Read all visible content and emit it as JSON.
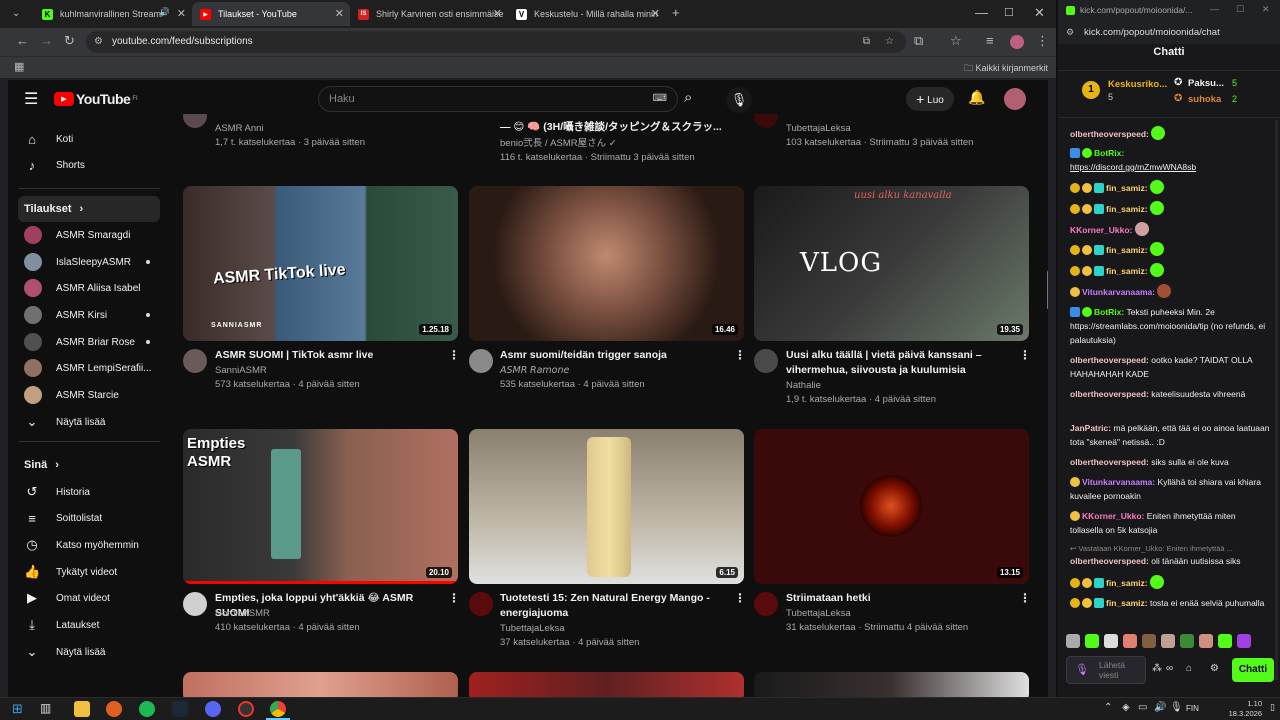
{
  "browser": {
    "tabs": [
      {
        "title": "kuhlmanvirallinen Stream -",
        "favicon": "K",
        "fav_color": "#53fc18"
      },
      {
        "title": "Tilaukset - YouTube",
        "favicon": "▶",
        "fav_color": "#ff0000"
      },
      {
        "title": "Shirly Karvinen osti ensimmäise",
        "favicon": "IS",
        "fav_color": "#d92020"
      },
      {
        "title": "Keskustelu - Millä rahalla minin",
        "favicon": "V",
        "fav_color": "#ffffff"
      }
    ],
    "url": "youtube.com/feed/subscriptions",
    "bookmarks_label": "Kaikki kirjanmerkit"
  },
  "youtube": {
    "logo_text": "YouTube",
    "logo_region": "FI",
    "search_placeholder": "Haku",
    "create_label": "Luo",
    "sidebar": {
      "main": [
        {
          "label": "Koti",
          "icon": "home-icon"
        },
        {
          "label": "Shorts",
          "icon": "shorts-icon"
        }
      ],
      "subs_heading": "Tilaukset",
      "subs": [
        {
          "label": "ASMR Smaragdi",
          "color": "#a04060",
          "dot": false
        },
        {
          "label": "IslaSleepyASMR",
          "color": "#8090a0",
          "dot": true
        },
        {
          "label": "ASMR Aliisa Isabel",
          "color": "#b05070",
          "dot": false
        },
        {
          "label": "ASMR Kirsi",
          "color": "#707070",
          "dot": true
        },
        {
          "label": "ASMR Briar Rose",
          "color": "#505050",
          "dot": true
        },
        {
          "label": "ASMR LempiSerafii...",
          "color": "#907060",
          "dot": false
        },
        {
          "label": "ASMR Starcie",
          "color": "#c0a080",
          "dot": false
        }
      ],
      "show_more": "Näytä lisää",
      "you_heading": "Sinä",
      "you": [
        {
          "label": "Historia",
          "icon": "history-icon"
        },
        {
          "label": "Soittolistat",
          "icon": "playlists-icon"
        },
        {
          "label": "Katso myöhemmin",
          "icon": "watch-later-icon"
        },
        {
          "label": "Tykätyt videot",
          "icon": "liked-icon"
        },
        {
          "label": "Omat videot",
          "icon": "your-videos-icon"
        },
        {
          "label": "Lataukset",
          "icon": "downloads-icon"
        }
      ],
      "show_more_2": "Näytä lisää"
    },
    "top_partial": [
      {
        "channel": "ASMR Anni",
        "meta": "1,7 t. katselukertaa · 3 päivää sitten"
      },
      {
        "title": "— 😊 🧠 (3H/囁き雑談/タッピング＆スクラッ...",
        "channel": "benio弐長 / ASMR屋さん ✓",
        "meta": "116 t. katselukertaa · Striimattu 3 päivää sitten"
      },
      {
        "channel": "TubettajaLeksa",
        "meta": "103 katselukertaa · Striimattu 3 päivää sitten"
      }
    ],
    "videos": [
      {
        "title": "ASMR SUOMI | TikTok asmr live",
        "channel": "SanniASMR",
        "meta": "573 katselukertaa · 4 päivää sitten",
        "duration": "1.25.18",
        "thumb_text": "ASMR TikTok live",
        "thumb_sub": "SANNIASMR"
      },
      {
        "title": "Asmr suomi/teidän trigger sanoja",
        "channel": "𝘈𝘚𝘔𝘙 𝘙𝘢𝘮𝘰𝘯𝘦",
        "meta": "535 katselukertaa · 4 päivää sitten",
        "duration": "16.46"
      },
      {
        "title": "Uusi alku täällä | vietä päivä kanssani – vihermehua, siivousta ja kuulumisia",
        "channel": "Nathalie",
        "meta": "1,9 t. katselukertaa · 4 päivää sitten",
        "duration": "19.35",
        "thumb_text": "VLOG",
        "thumb_sub": "uusi alku kanavalla"
      },
      {
        "title": "Empties, joka loppui yht'äkkiä 😂 ASMR SUOMI",
        "channel": "NordicASMR",
        "meta": "410 katselukertaa · 4 päivää sitten",
        "duration": "20.10",
        "thumb_text": "Empties ASMR"
      },
      {
        "title": "Tuotetesti 15: Zen Natural Energy Mango - energiajuoma",
        "channel": "TubettajaLeksa",
        "meta": "37 katselukertaa · 4 päivää sitten",
        "duration": "6.15"
      },
      {
        "title": "Striimataan hetki",
        "channel": "TubettajaLeksa",
        "meta": "31 katselukertaa · Striimattu 4 päivää sitten",
        "duration": "13.15"
      }
    ]
  },
  "chat": {
    "popout_url": "kick.com/popout/moioonida/...",
    "address": "kick.com/popout/moioonida/chat",
    "title": "Chatti",
    "leaderboard": [
      {
        "name": "Keskusriko...",
        "count": "5"
      },
      {
        "name": "Paksu...",
        "count": "5"
      },
      {
        "name": "suhoka",
        "count": "2"
      }
    ],
    "messages": [
      {
        "user": "olbertheoverspeed:",
        "color": "#f0c0c0",
        "text": "",
        "emote": true
      },
      {
        "user": "BotRix:",
        "color": "#53fc18",
        "text": "https://discord.gg/mZmwWNA8sb",
        "link": true
      },
      {
        "user": "fin_samiz:",
        "color": "#ffd36a",
        "text": "",
        "emote": true
      },
      {
        "user": "fin_samiz:",
        "color": "#ffd36a",
        "text": "",
        "emote": true
      },
      {
        "user": "KKorner_Ukko:",
        "color": "#ff79c6",
        "text": "",
        "emote": true
      },
      {
        "user": "fin_samiz:",
        "color": "#ffd36a",
        "text": "",
        "emote": true
      },
      {
        "user": "fin_samiz:",
        "color": "#ffd36a",
        "text": "",
        "emote": true
      },
      {
        "user": "Vitunkarvanaama:",
        "color": "#c77dff",
        "text": "",
        "emote": true
      },
      {
        "user": "BotRix:",
        "color": "#53fc18",
        "text": "Teksti puheeksi Min. 2e https://streamlabs.com/moioonida/tip (no refunds, ei palautuksia)"
      },
      {
        "user": "olbertheoverspeed:",
        "color": "#f0c0c0",
        "text": "ootko kade? TAIDAT OLLA HAHAHAHAH KADE"
      },
      {
        "user": "olbertheoverspeed:",
        "color": "#f0c0c0",
        "text": "kateelisuudesta vihreenä"
      },
      {
        "user": "JanPatric:",
        "color": "#f0c0c0",
        "text": "mä pelkään, että tää ei oo ainoa laatuaan tota \"skeneä\" netissä.. :D"
      },
      {
        "user": "olbertheoverspeed:",
        "color": "#f0c0c0",
        "text": "siks sulla ei ole kuva"
      },
      {
        "user": "Vitunkarvanaama:",
        "color": "#c77dff",
        "text": "Kyllähä toi shiara vai khiara kuvailee pornoakin"
      },
      {
        "user": "KKorner_Ukko:",
        "color": "#ff79c6",
        "text": "Eniten ihmetyttää miten tollasella on 5k katsojia"
      },
      {
        "user": "olbertheoverspeed:",
        "color": "#f0c0c0",
        "text": "oli tänään uutisissa siks",
        "reply": "↩ Vastataan KKorner_Ukko: Eniten ihmetyttää ..."
      },
      {
        "user": "fin_samiz:",
        "color": "#ffd36a",
        "text": "",
        "emote": true
      },
      {
        "user": "fin_samiz:",
        "color": "#ffd36a",
        "text": "tosta ei enää selviä puhumalla"
      }
    ],
    "input_placeholder": "Lähetä viesti",
    "send_label": "Chatti"
  },
  "taskbar": {
    "lang": "FIN",
    "time": "1.10",
    "date": "18.3.2026"
  }
}
